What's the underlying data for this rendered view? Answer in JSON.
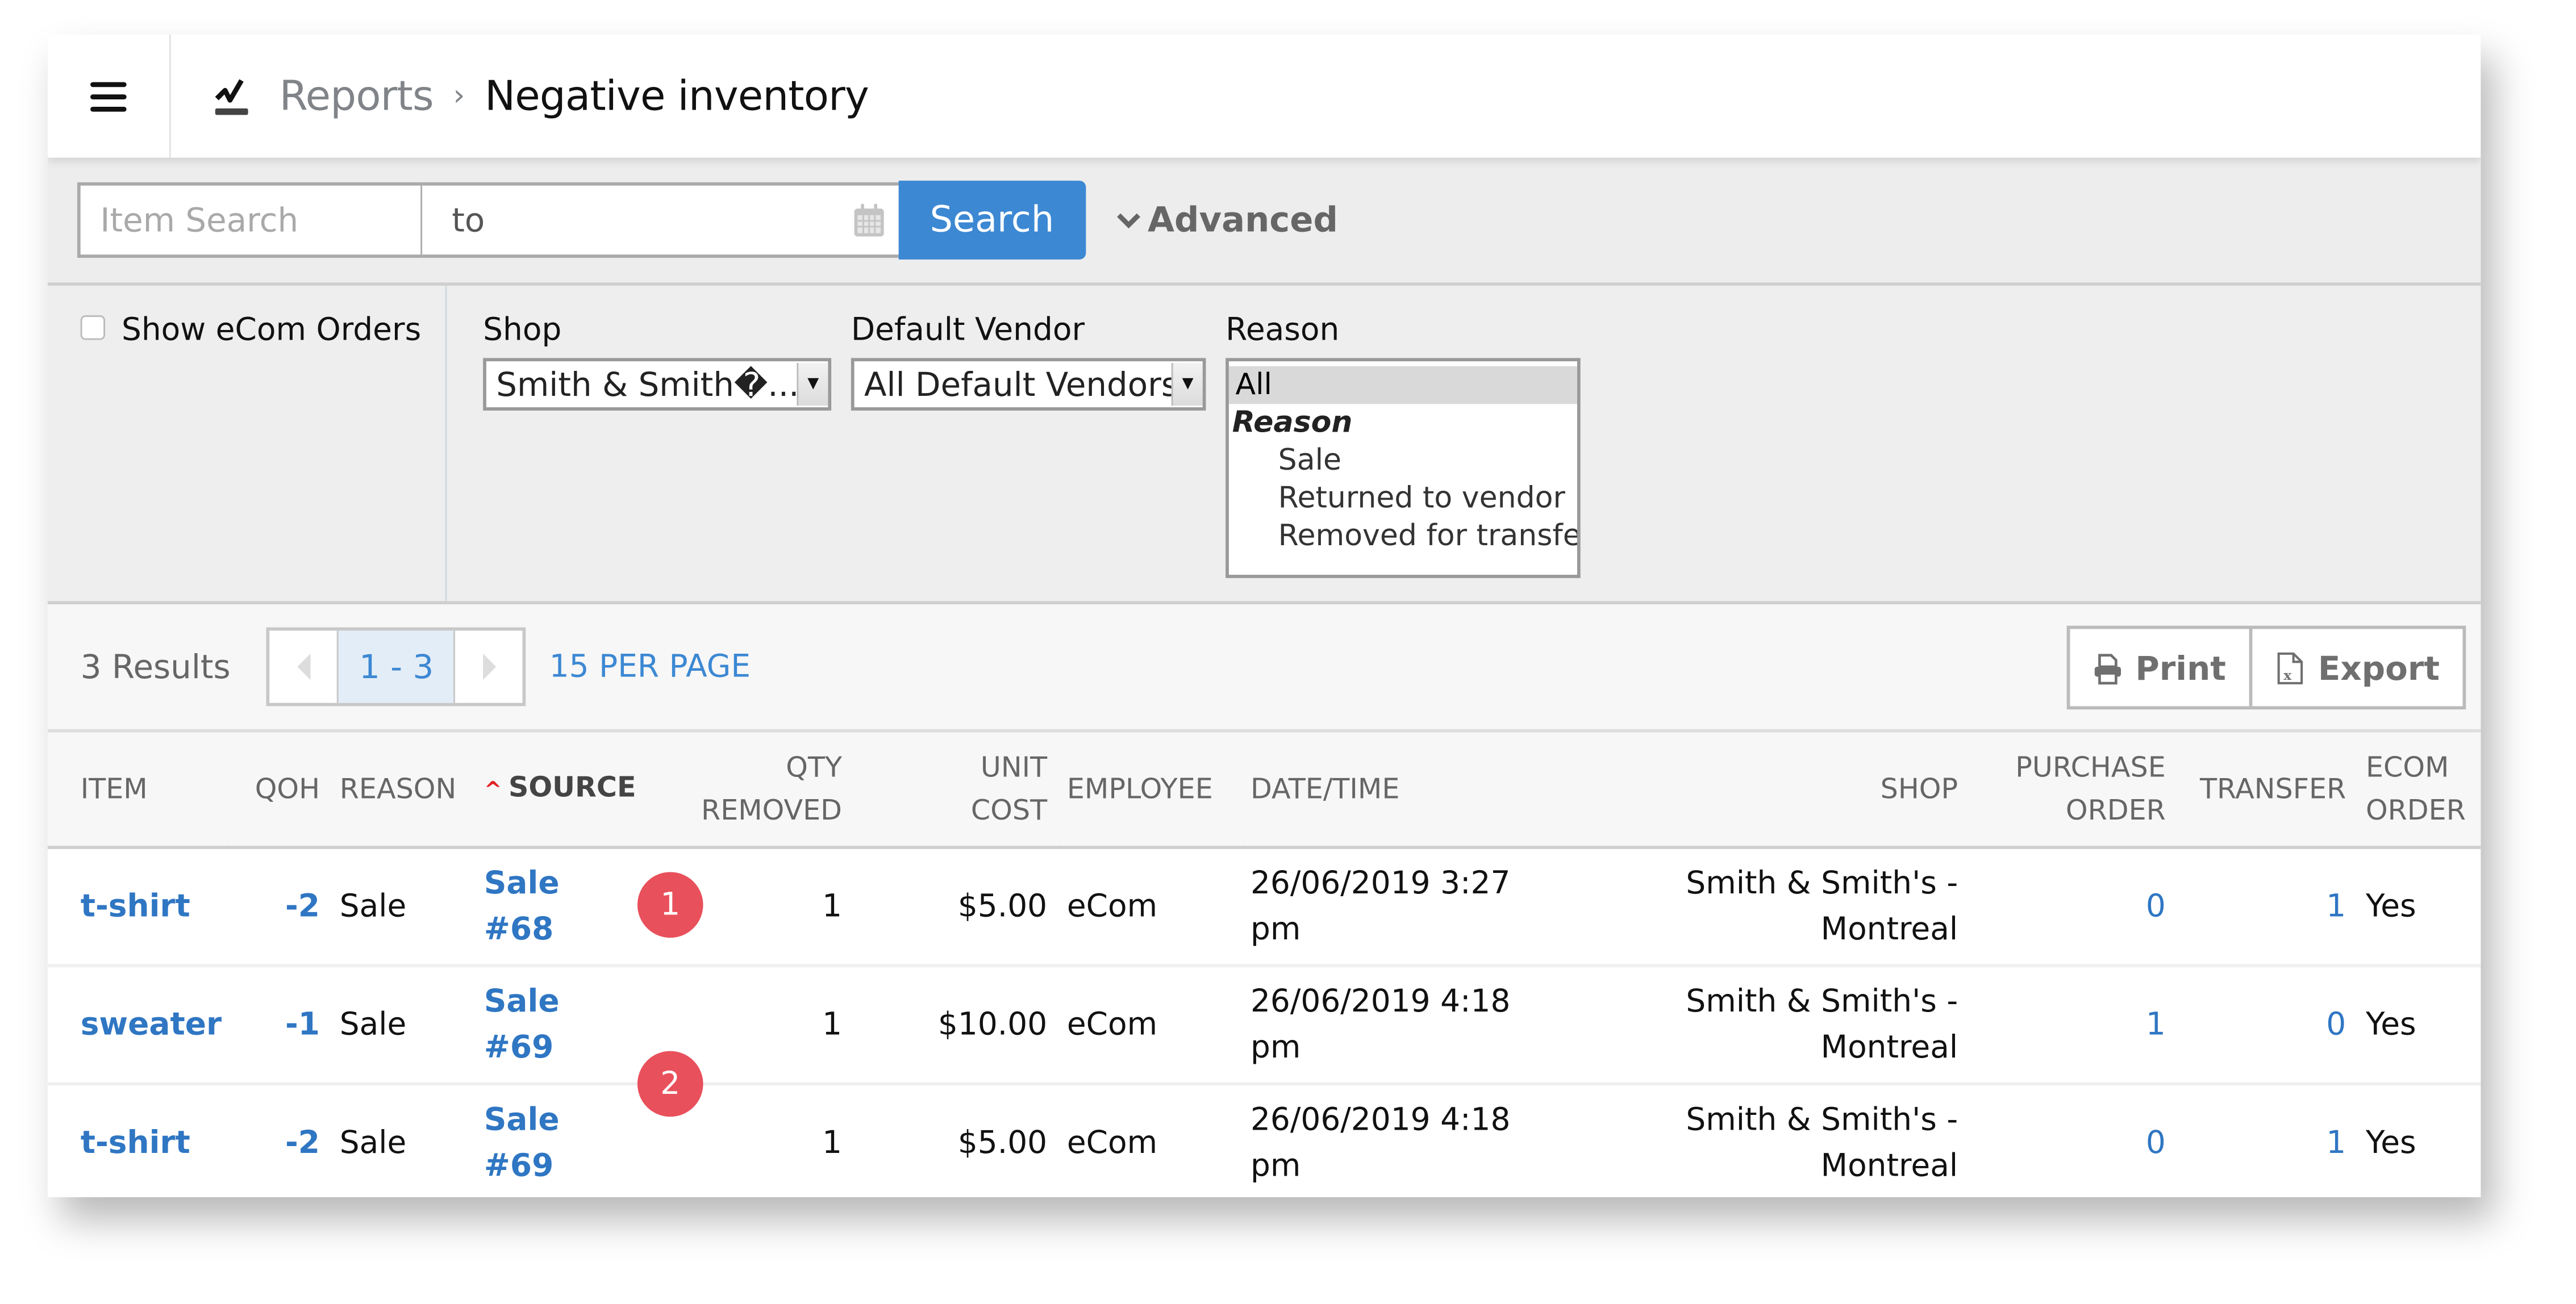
{
  "header": {
    "menu_icon": "hamburger-menu-icon",
    "reports_icon": "reports-chart-icon",
    "breadcrumb_parent": "Reports",
    "breadcrumb_separator": "›",
    "page_title": "Negative inventory"
  },
  "search": {
    "item_placeholder": "Item Search",
    "item_value": "",
    "date_value": "to",
    "search_label": "Search",
    "advanced_label": "Advanced"
  },
  "filters": {
    "show_ecom_label": "Show eCom Orders",
    "show_ecom_checked": false,
    "shop_label": "Shop",
    "shop_value": "Smith & Smith�...",
    "vendor_label": "Default Vendor",
    "vendor_value": "All Default Vendors",
    "reason_label": "Reason",
    "reason_options": {
      "all": "All",
      "group": "Reason",
      "sale": "Sale",
      "returned": "Returned to vendor",
      "transfer": "Removed for transfer"
    },
    "reason_selected": "All"
  },
  "results": {
    "count_label": "3 Results",
    "page_range": "1 - 3",
    "per_page": "15 PER PAGE",
    "print_label": "Print",
    "export_label": "Export"
  },
  "table": {
    "columns": {
      "item": "ITEM",
      "qoh": "QOH",
      "reason": "REASON",
      "source": "SOURCE",
      "qty_removed_1": "QTY",
      "qty_removed_2": "REMOVED",
      "unit_cost_1": "UNIT",
      "unit_cost_2": "COST",
      "employee": "EMPLOYEE",
      "datetime": "DATE/TIME",
      "shop": "SHOP",
      "po_1": "PURCHASE",
      "po_2": "ORDER",
      "transfer": "TRANSFER",
      "ecom_1": "ECOM",
      "ecom_2": "ORDER"
    },
    "sort_column": "SOURCE",
    "sort_direction": "ascending",
    "rows": [
      {
        "item": "t-shirt",
        "qoh": "-2",
        "reason": "Sale",
        "source": "Sale #68",
        "qty_removed": "1",
        "unit_cost": "$5.00",
        "employee": "eCom",
        "datetime": "26/06/2019 3:27 pm",
        "shop": "Smith & Smith's -\nMontreal",
        "purchase_order": "0",
        "transfer": "1",
        "ecom_order": "Yes"
      },
      {
        "item": "sweater",
        "qoh": "-1",
        "reason": "Sale",
        "source": "Sale #69",
        "qty_removed": "1",
        "unit_cost": "$10.00",
        "employee": "eCom",
        "datetime": "26/06/2019 4:18 pm",
        "shop": "Smith & Smith's -\nMontreal",
        "purchase_order": "1",
        "transfer": "0",
        "ecom_order": "Yes"
      },
      {
        "item": "t-shirt",
        "qoh": "-2",
        "reason": "Sale",
        "source": "Sale #69",
        "qty_removed": "1",
        "unit_cost": "$5.00",
        "employee": "eCom",
        "datetime": "26/06/2019 4:18 pm",
        "shop": "Smith & Smith's -\nMontreal",
        "purchase_order": "0",
        "transfer": "1",
        "ecom_order": "Yes"
      }
    ]
  },
  "annotations": [
    {
      "label": "1"
    },
    {
      "label": "2"
    }
  ],
  "colors": {
    "accent": "#3c88d3",
    "link": "#2f76c3",
    "badge": "#e8505b",
    "sort_arrow": "#e02020"
  }
}
